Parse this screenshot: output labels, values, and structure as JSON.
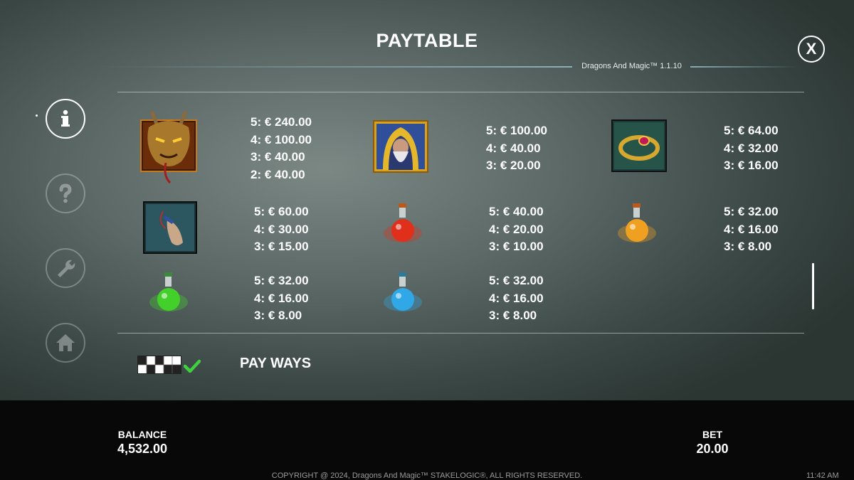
{
  "header": {
    "title": "PAYTABLE",
    "version": "Dragons And Magic™ 1.1.10",
    "close_label": "X"
  },
  "sidebar": {
    "items": [
      {
        "name": "info",
        "icon": "info-icon",
        "active": true
      },
      {
        "name": "help",
        "icon": "question-icon",
        "active": false
      },
      {
        "name": "settings",
        "icon": "wrench-icon",
        "active": false
      },
      {
        "name": "home",
        "icon": "home-icon",
        "active": false
      }
    ]
  },
  "paytable": {
    "symbols": [
      {
        "name": "dragon",
        "pays": [
          "5: € 240.00",
          "4: € 100.00",
          "3: € 40.00",
          "2: € 40.00"
        ]
      },
      {
        "name": "wizard",
        "pays": [
          "5: € 100.00",
          "4: € 40.00",
          "3: € 20.00"
        ]
      },
      {
        "name": "ring",
        "pays": [
          "5: € 64.00",
          "4: € 32.00",
          "3: € 16.00"
        ]
      },
      {
        "name": "scroll",
        "pays": [
          "5: € 60.00",
          "4: € 30.00",
          "3: € 15.00"
        ]
      },
      {
        "name": "red-potion",
        "pays": [
          "5: € 40.00",
          "4: € 20.00",
          "3: € 10.00"
        ]
      },
      {
        "name": "orange-potion",
        "pays": [
          "5: € 32.00",
          "4: € 16.00",
          "3: € 8.00"
        ]
      },
      {
        "name": "green-potion",
        "pays": [
          "5: € 32.00",
          "4: € 16.00",
          "3: € 8.00"
        ]
      },
      {
        "name": "blue-potion",
        "pays": [
          "5: € 32.00",
          "4: € 16.00",
          "3: € 8.00"
        ]
      }
    ],
    "ways_label": "PAY WAYS"
  },
  "footer": {
    "balance_label": "BALANCE",
    "balance_value": "4,532.00",
    "bet_label": "BET",
    "bet_value": "20.00",
    "copyright": "COPYRIGHT @ 2024, Dragons And Magic™ STAKELOGIC®, ALL RIGHTS RESERVED.",
    "clock": "11:42 AM"
  },
  "colors": {
    "accent_check": "#3fcf3f",
    "footer_bg": "#080808",
    "potion_red": "#e0301c",
    "potion_orange": "#f0a020",
    "potion_green": "#44d02a",
    "potion_blue": "#30a8e8"
  }
}
